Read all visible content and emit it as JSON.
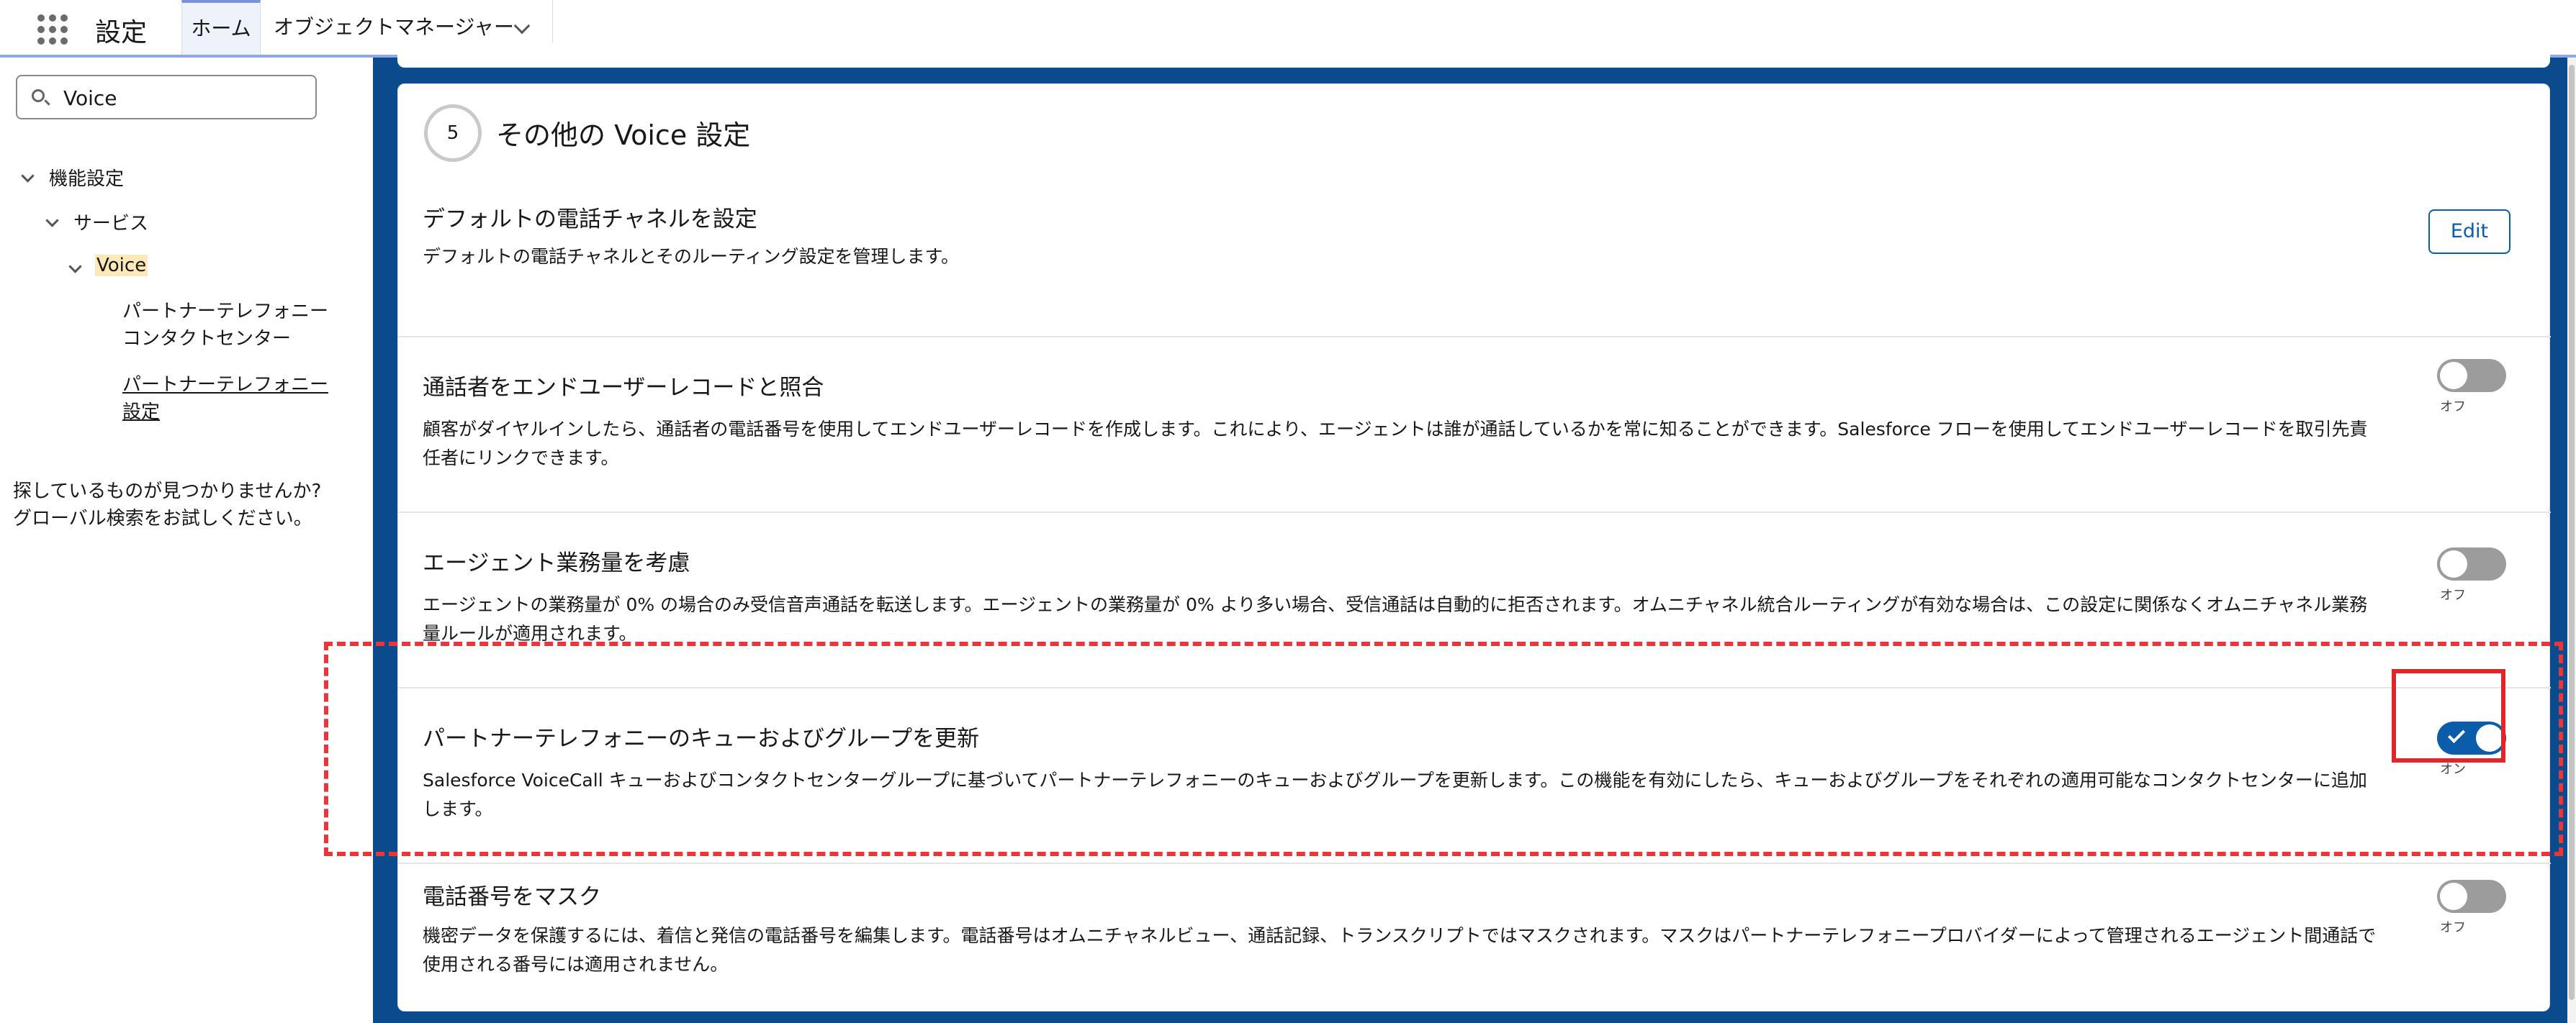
{
  "header": {
    "app_title": "設定",
    "tabs": [
      {
        "label": "ホーム"
      },
      {
        "label": "オブジェクトマネージャー"
      }
    ]
  },
  "sidebar": {
    "search": {
      "value": "Voice",
      "placeholder": ""
    },
    "tree": {
      "level1": "機能設定",
      "level2": "サービス",
      "level3": "Voice",
      "leaves": [
        {
          "line1": "パートナーテレフォニー",
          "line2": "コンタクトセンター"
        },
        {
          "line1": "パートナーテレフォニー",
          "line2": "設定"
        }
      ]
    },
    "help_line1": "探しているものが見つかりませんか?",
    "help_line2": "グローバル検索をお試しください。"
  },
  "main": {
    "step_number": "5",
    "card_title": "その他の Voice 設定",
    "items": [
      {
        "title": "デフォルトの電話チャネルを設定",
        "description": "デフォルトの電話チャネルとそのルーティング設定を管理します。",
        "button_label": "Edit"
      },
      {
        "title": "通話者をエンドユーザーレコードと照合",
        "description": "顧客がダイヤルインしたら、通話者の電話番号を使用してエンドユーザーレコードを作成します。これにより、エージェントは誰が通話しているかを常に知ることができます。Salesforce フローを使用してエンドユーザーレコードを取引先責任者にリンクできます。",
        "toggle_state": "off",
        "toggle_label": "オフ"
      },
      {
        "title": "エージェント業務量を考慮",
        "description": "エージェントの業務量が 0% の場合のみ受信音声通話を転送します。エージェントの業務量が 0% より多い場合、受信通話は自動的に拒否されます。オムニチャネル統合ルーティングが有効な場合は、この設定に関係なくオムニチャネル業務量ルールが適用されます。",
        "toggle_state": "off",
        "toggle_label": "オフ"
      },
      {
        "title": "パートナーテレフォニーのキューおよびグループを更新",
        "description": "Salesforce VoiceCall キューおよびコンタクトセンターグループに基づいてパートナーテレフォニーのキューおよびグループを更新します。この機能を有効にしたら、キューおよびグループをそれぞれの適用可能なコンタクトセンターに追加します。",
        "toggle_state": "on",
        "toggle_label": "オン"
      },
      {
        "title": "電話番号をマスク",
        "description": "機密データを保護するには、着信と発信の電話番号を編集します。電話番号はオムニチャネルビュー、通話記録、トランスクリプトではマスクされます。マスクはパートナーテレフォニープロバイダーによって管理されるエージェント間通話で使用される番号には適用されません。",
        "toggle_state": "off",
        "toggle_label": "オフ"
      }
    ]
  },
  "colors": {
    "brand_blue": "#0b5cab",
    "main_background": "#0b4a8c",
    "annotation_red": "#e8363a",
    "highlight": "#fde8b8"
  }
}
